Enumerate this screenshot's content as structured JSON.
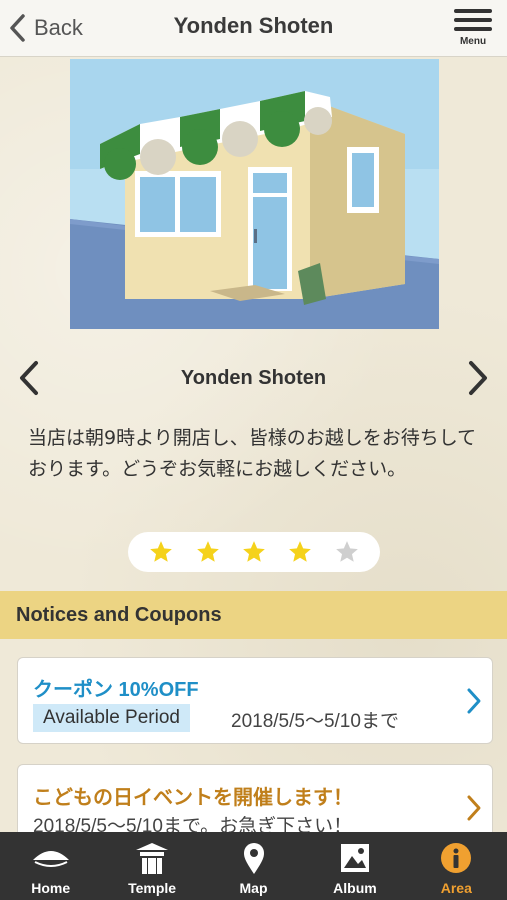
{
  "header": {
    "back_label": "Back",
    "title": "Yonden Shoten",
    "menu_label": "Menu"
  },
  "carousel": {
    "shop_name": "Yonden Shoten",
    "description": "当店は朝9時より開店し、皆様のお越しをお待ちしております。どうぞお気軽にお越しください。"
  },
  "rating": {
    "value": 4,
    "max": 5,
    "filled_color": "#f5d21b",
    "empty_color": "#cfcfcf"
  },
  "section": {
    "title": "Notices and Coupons"
  },
  "cards": [
    {
      "title": "クーポン 10%OFF",
      "badge": "Available Period",
      "period": "2018/5/5～5/10まで"
    },
    {
      "title": "こどもの日イベントを開催します！",
      "subtitle": "2018/5/5～5/10まで。お急ぎ下さい！"
    }
  ],
  "tabbar": {
    "items": [
      {
        "label": "Home",
        "icon": "home-icon"
      },
      {
        "label": "Temple",
        "icon": "temple-icon"
      },
      {
        "label": "Map",
        "icon": "map-pin-icon"
      },
      {
        "label": "Album",
        "icon": "album-icon"
      },
      {
        "label": "Area",
        "icon": "info-icon",
        "active": true
      }
    ],
    "active_color": "#f0a030"
  }
}
